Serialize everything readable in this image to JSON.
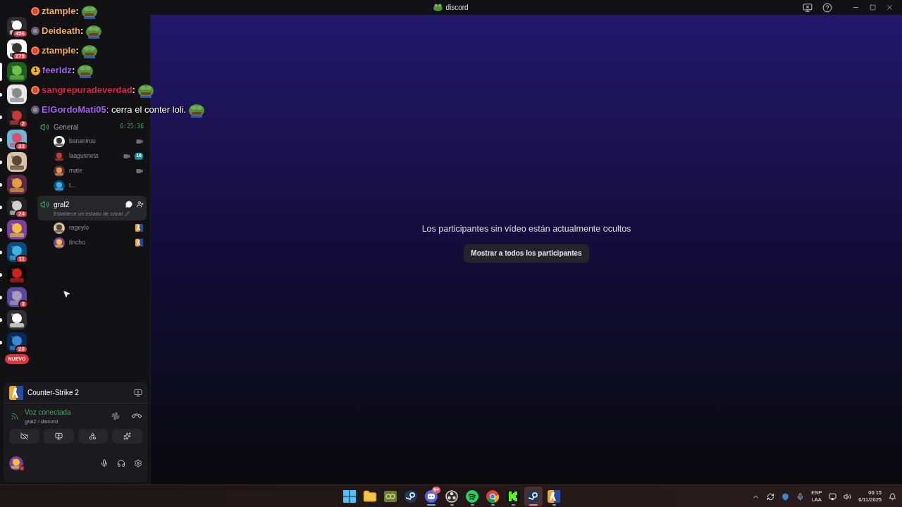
{
  "window": {
    "title": "discord"
  },
  "servers": [
    {
      "badge": "456",
      "unread": false,
      "selected": false
    },
    {
      "badge": "275",
      "unread": false,
      "selected": false
    },
    {
      "unread": false,
      "selected": true
    },
    {
      "unread": true,
      "selected": false
    },
    {
      "badge": "2",
      "unread": true,
      "selected": false
    },
    {
      "badge": "33",
      "unread": true,
      "selected": false
    },
    {
      "unread": true,
      "selected": false
    },
    {
      "unread": true,
      "selected": false
    },
    {
      "badge": "24",
      "unread": true,
      "selected": false
    },
    {
      "unread": true,
      "selected": false
    },
    {
      "badge": "11",
      "unread": true,
      "selected": false
    },
    {
      "unread": true,
      "selected": false
    },
    {
      "badge": "3",
      "unread": true,
      "selected": false
    },
    {
      "unread": true,
      "selected": false
    },
    {
      "badge": "20",
      "unread": true,
      "selected": false
    }
  ],
  "new_pill": "NUEVO",
  "chat_overlay": [
    {
      "kind": "dot",
      "user": "ztample",
      "color": "#f4b04c",
      "text": ":"
    },
    {
      "kind": "ring",
      "user": "Deideath",
      "color": "#f4b04c",
      "text": ":"
    },
    {
      "kind": "dot",
      "user": "ztample",
      "color": "#f4b04c",
      "text": ":"
    },
    {
      "kind": "number",
      "badge": "1",
      "user": "feerldz",
      "color": "#a662f2",
      "text": ":"
    },
    {
      "kind": "dot",
      "user": "sangrepuradeverdad",
      "color": "#e3224e",
      "text": ":"
    },
    {
      "kind": "ring",
      "user": "ElGordoMati05",
      "color": "#a662f2",
      "text": ": cerra el conter loli."
    }
  ],
  "voice_channels": [
    {
      "name": "General",
      "selected": false,
      "timer": "6:25:36",
      "members": [
        {
          "name": "bananirou",
          "camera": true,
          "game": false
        },
        {
          "name": "laagusneta",
          "camera": true,
          "game": false,
          "badge": "16"
        },
        {
          "name": "mate",
          "camera": true,
          "game": false
        },
        {
          "name": "t...",
          "camera": false,
          "game": false
        }
      ]
    },
    {
      "name": "gral2",
      "selected": true,
      "status": "Establece un estado de canal",
      "members": [
        {
          "name": "rageylo",
          "camera": false,
          "game": true
        },
        {
          "name": "tincho",
          "camera": false,
          "game": true
        }
      ]
    }
  ],
  "main": {
    "notice": "Los participantes sin vídeo están actualmente ocultos",
    "button": "Mostrar a todos los participantes"
  },
  "user_panel": {
    "activity": "Counter-Strike 2",
    "voice_status": "Voz conectada",
    "voice_channel": "gral2 / discord"
  },
  "taskbar": {
    "apps": [
      {
        "kind": "windows",
        "running": false,
        "selected": false
      },
      {
        "kind": "folder",
        "running": false,
        "selected": false
      },
      {
        "kind": "launcher",
        "running": false,
        "selected": false
      },
      {
        "kind": "steam",
        "running": false,
        "selected": false
      },
      {
        "kind": "discord",
        "running": true,
        "selected": false,
        "badge": "9+"
      },
      {
        "kind": "obs",
        "running": true,
        "selected": false
      },
      {
        "kind": "spotify",
        "running": true,
        "selected": false
      },
      {
        "kind": "chrome",
        "running": true,
        "selected": false
      },
      {
        "kind": "kick",
        "running": true,
        "selected": false
      },
      {
        "kind": "steam",
        "running": true,
        "selected": true
      },
      {
        "kind": "cs",
        "running": true,
        "selected": false
      }
    ],
    "language": [
      "ESP",
      "LAA"
    ],
    "time": "06:15",
    "date": "6/11/2025"
  }
}
